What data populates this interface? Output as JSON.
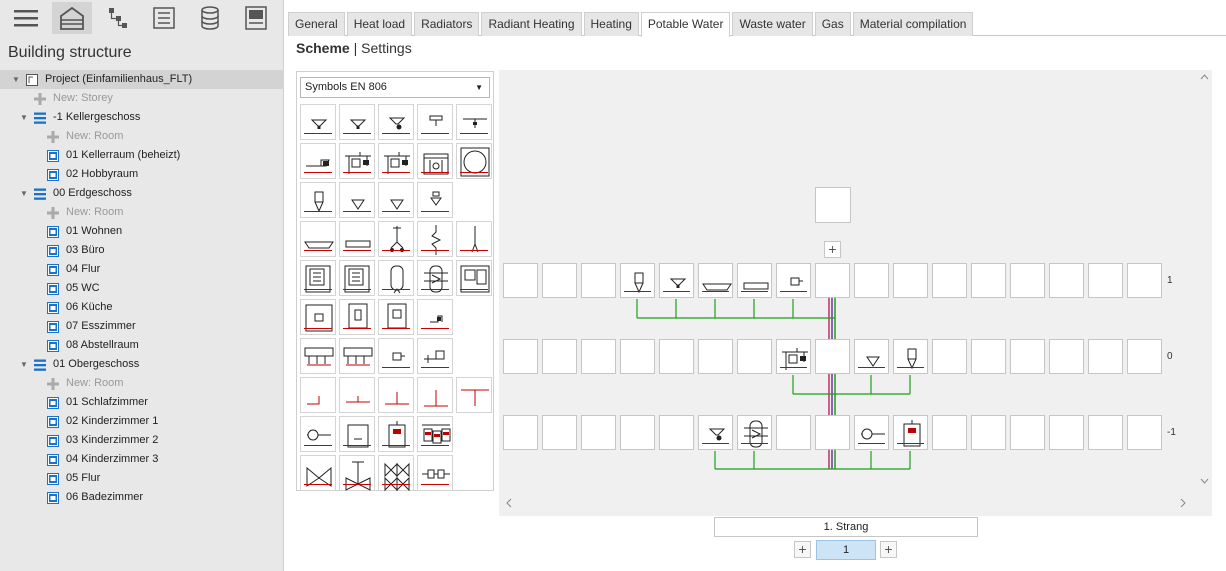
{
  "toolbar": {
    "icons": [
      "menu-icon",
      "building-icon",
      "network-icon",
      "list-icon",
      "database-icon",
      "panel-icon"
    ]
  },
  "sidebar": {
    "title": "Building structure",
    "tree": [
      {
        "label": "Project (Einfamilienhaus_FLT)",
        "type": "project",
        "level": 0
      },
      {
        "label": "New: Storey",
        "type": "new",
        "level": 1
      },
      {
        "label": "-1 Kellergeschoss",
        "type": "storey",
        "level": 1
      },
      {
        "label": "New: Room",
        "type": "new",
        "level": 2
      },
      {
        "label": "01 Kellerraum (beheizt)",
        "type": "room",
        "level": 2
      },
      {
        "label": "02 Hobbyraum",
        "type": "room",
        "level": 2
      },
      {
        "label": "00 Erdgeschoss",
        "type": "storey",
        "level": 1
      },
      {
        "label": "New: Room",
        "type": "new",
        "level": 2
      },
      {
        "label": "01 Wohnen",
        "type": "room",
        "level": 2
      },
      {
        "label": "03 Büro",
        "type": "room",
        "level": 2
      },
      {
        "label": "04 Flur",
        "type": "room",
        "level": 2
      },
      {
        "label": "05 WC",
        "type": "room",
        "level": 2
      },
      {
        "label": "06 Küche",
        "type": "room",
        "level": 2
      },
      {
        "label": "07 Esszimmer",
        "type": "room",
        "level": 2
      },
      {
        "label": "08 Abstellraum",
        "type": "room",
        "level": 2
      },
      {
        "label": "01 Obergeschoss",
        "type": "storey",
        "level": 1
      },
      {
        "label": "New: Room",
        "type": "new",
        "level": 2
      },
      {
        "label": "01 Schlafzimmer",
        "type": "room",
        "level": 2
      },
      {
        "label": "02 Kinderzimmer 1",
        "type": "room",
        "level": 2
      },
      {
        "label": "03 Kinderzimmer 2",
        "type": "room",
        "level": 2
      },
      {
        "label": "04 Kinderzimmer 3",
        "type": "room",
        "level": 2
      },
      {
        "label": "05 Flur",
        "type": "room",
        "level": 2
      },
      {
        "label": "06 Badezimmer",
        "type": "room",
        "level": 2
      }
    ]
  },
  "tabs": [
    "General",
    "Heat load",
    "Radiators",
    "Radiant Heating",
    "Heating",
    "Potable Water",
    "Waste water",
    "Gas",
    "Material compilation"
  ],
  "active_tab": "Potable Water",
  "subtabs": {
    "scheme": "Scheme",
    "separator": "|",
    "settings": "Settings"
  },
  "palette": {
    "select_value": "Symbols EN 806"
  },
  "levels": [
    "1",
    "0",
    "-1"
  ],
  "strang": "1. Strang",
  "page": "1",
  "colors": {
    "pipe_green": "#1aa01a",
    "riser_red": "#c0306a",
    "riser_purple": "#7030a0",
    "accent_blue": "#1a73c8",
    "red_line": "#c00000"
  }
}
